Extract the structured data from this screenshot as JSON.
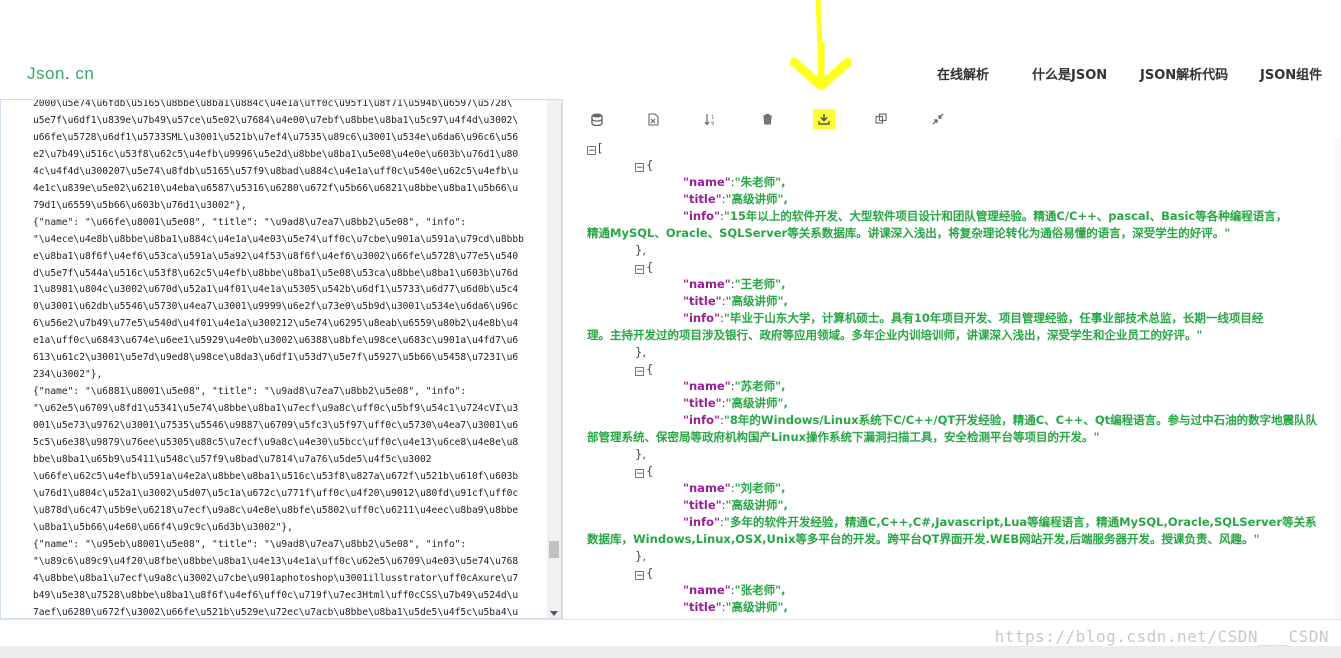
{
  "header": {
    "logo_main": "Json",
    "logo_dot": ".",
    "logo_tld": " cn",
    "nav": [
      "在线解析",
      "什么是JSON",
      "JSON解析代码",
      "JSON组件"
    ]
  },
  "editor_lines": [
    "2000\\u5e74\\u6fdb\\u5165\\u8bbe\\u8ba1\\u884c\\u4e1a\\uff0c\\u95f1\\u8f71\\u594b\\u6597\\u5728\\",
    "u5e7f\\u6df1\\u839e\\u7b49\\u57ce\\u5e02\\u7684\\u4e00\\u7ebf\\u8bbe\\u8ba1\\u5c97\\u4f4d\\u3002\\",
    "u66fe\\u5728\\u6df1\\u5733SML\\u3001\\u521b\\u7ef4\\u7535\\u89c6\\u3001\\u534e\\u6da6\\u96c6\\u56",
    "e2\\u7b49\\u516c\\u53f8\\u62c5\\u4efb\\u9996\\u5e2d\\u8bbe\\u8ba1\\u5e08\\u4e0e\\u603b\\u76d1\\u80",
    "4c\\u4f4d\\u300207\\u5e74\\u8fdb\\u5165\\u57f9\\u8bad\\u884c\\u4e1a\\uff0c\\u540e\\u62c5\\u4efb\\u",
    "4e1c\\u839e\\u5e02\\u6210\\u4eba\\u6587\\u5316\\u6280\\u672f\\u5b66\\u6821\\u8bbe\\u8ba1\\u5b66\\u",
    "79d1\\u6559\\u5b66\\u603b\\u76d1\\u3002\"},",
    "{\"name\": \"\\u66fe\\u8001\\u5e08\", \"title\": \"\\u9ad8\\u7ea7\\u8bb2\\u5e08\", \"info\":",
    "\"\\u4ece\\u4e8b\\u8bbe\\u8ba1\\u884c\\u4e1a\\u4e03\\u5e74\\uff0c\\u7cbe\\u901a\\u591a\\u79cd\\u8bbb",
    "e\\u8ba1\\u8f6f\\u4ef6\\u53ca\\u591a\\u5a92\\u4f53\\u8f6f\\u4ef6\\u3002\\u66fe\\u5728\\u77e5\\u540",
    "d\\u5e7f\\u544a\\u516c\\u53f8\\u62c5\\u4efb\\u8bbe\\u8ba1\\u5e08\\u53ca\\u8bbe\\u8ba1\\u603b\\u76d",
    "1\\u8981\\u804c\\u3002\\u670d\\u52a1\\u4f01\\u4e1a\\u5305\\u542b\\u6df1\\u5733\\u6d77\\u6d0b\\u5c4",
    "0\\u3001\\u62db\\u5546\\u5730\\u4ea7\\u3001\\u9999\\u6e2f\\u73e0\\u5b9d\\u3001\\u534e\\u6da6\\u96c",
    "6\\u56e2\\u7b49\\u77e5\\u540d\\u4f01\\u4e1a\\u300212\\u5e74\\u6295\\u8eab\\u6559\\u80b2\\u4e8b\\u4",
    "e1a\\uff0c\\u6843\\u674e\\u6ee1\\u5929\\u4e0b\\u3002\\u6388\\u8bfe\\u98ce\\u683c\\u901a\\u4fd7\\u6",
    "613\\u61c2\\u3001\\u5e7d\\u9ed8\\u98ce\\u8da3\\u6df1\\u53d7\\u5e7f\\u5927\\u5b66\\u5458\\u7231\\u6",
    "234\\u3002\"},",
    "{\"name\": \"\\u6881\\u8001\\u5e08\", \"title\": \"\\u9ad8\\u7ea7\\u8bb2\\u5e08\", \"info\":",
    "\"\\u62e5\\u6709\\u8fd1\\u5341\\u5e74\\u8bbe\\u8ba1\\u7ecf\\u9a8c\\uff0c\\u5bf9\\u54c1\\u724cVI\\u3",
    "001\\u5e73\\u9762\\u3001\\u7535\\u5546\\u9887\\u6709\\u5fc3\\u5f97\\uff0c\\u5730\\u4ea7\\u3001\\u6",
    "5c5\\u6e38\\u9879\\u76ee\\u5305\\u88c5\\u7ecf\\u9a8c\\u4e30\\u5bcc\\uff0c\\u4e13\\u6ce8\\u4e8e\\u8",
    "bbe\\u8ba1\\u65b9\\u5411\\u548c\\u57f9\\u8bad\\u7814\\u7a76\\u5de5\\u4f5c\\u3002",
    "\\u66fe\\u62c5\\u4efb\\u591a\\u4e2a\\u8bbe\\u8ba1\\u516c\\u53f8\\u827a\\u672f\\u521b\\u610f\\u603b",
    "\\u76d1\\u804c\\u52a1\\u3002\\u5d07\\u5c1a\\u672c\\u771f\\uff0c\\u4f20\\u9012\\u80fd\\u91cf\\uff0c",
    "\\u878d\\u6c47\\u5b9e\\u6218\\u7ecf\\u9a8c\\u4e8e\\u8bfe\\u5802\\uff0c\\u6211\\u4eec\\u8ba9\\u8bbe",
    "\\u8ba1\\u5b66\\u4e60\\u66f4\\u9c9c\\u6d3b\\u3002\"},",
    "{\"name\": \"\\u95eb\\u8001\\u5e08\", \"title\": \"\\u9ad8\\u7ea7\\u8bb2\\u5e08\", \"info\":",
    "\"\\u89c6\\u89c9\\u4f20\\u8fbe\\u8bbe\\u8ba1\\u4e13\\u4e1a\\uff0c\\u62e5\\u6709\\u4e03\\u5e74\\u768",
    "4\\u8bbe\\u8ba1\\u7ecf\\u9a8c\\u3002\\u7cbe\\u901aphotoshop\\u3001illusstrator\\uff0cAxure\\u7",
    "b49\\u5e38\\u7528\\u8bbe\\u8ba1\\u8f6f\\u4ef6\\uff0c\\u719f\\u7ec3Html\\uff0cCSS\\u7b49\\u524d\\u",
    "7aef\\u6280\\u672f\\u3002\\u66fe\\u521b\\u529e\\u72ec\\u7acb\\u8bbe\\u8ba1\\u5de5\\u4f5c\\u5ba4\\u"
  ],
  "toolbar": {
    "icons": [
      "database-icon",
      "excel-icon",
      "sort-icon",
      "trash-icon",
      "download-icon",
      "copy-icon",
      "compress-icon"
    ]
  },
  "json_view": {
    "open_bracket": "[",
    "teachers": [
      {
        "name": "朱老师",
        "title": "高级讲师",
        "info_1": "15年以上的软件开发、大型软件项目设计和团队管理经验。精通C/C++、pascal、Basic等各种编程语言，",
        "info_2": "精通MySQL、Oracle、SQLServer等关系数据库。讲课深入浅出，将复杂理论转化为通俗易懂的语言，深受学生的好评。\""
      },
      {
        "name": "王老师",
        "title": "高级讲师",
        "info_1": "毕业于山东大学，计算机硕士。具有10年项目开发、项目管理经验，任事业部技术总监，长期一线项目经",
        "info_2": "理。主持开发过的项目涉及银行、政府等应用领域。多年企业内训培训师，讲课深入浅出，深受学生和企业员工的好评。\""
      },
      {
        "name": "苏老师",
        "title": "高级讲师",
        "info_1": "8年的Windows/Linux系统下C/C++/QT开发经验，精通C、C++、Qt编程语言。参与过中石油的数字地震队队",
        "info_2": "部管理系统、保密局等政府机构国产Linux操作系统下漏洞扫描工具，安全检测平台等项目的开发。\""
      },
      {
        "name": "刘老师",
        "title": "高级讲师",
        "info_1": "多年的软件开发经验，精通C,C++,C#,Javascript,Lua等编程语言，精通MySQL,Oracle,SQLServer等关系",
        "info_2": "数据库，Windows,Linux,OSX,Unix等多平台的开发。跨平台QT界面开发.WEB网站开发,后端服务器开发。授课负责、风趣。\""
      },
      {
        "name": "张老师",
        "title": "高级讲师"
      }
    ]
  },
  "watermark": "https://blog.csdn.net/CSDN___CSDN",
  "colors": {
    "key": "#9b1d9b",
    "string": "#28a745",
    "highlight": "#ffff33",
    "logo": "#3aa56a"
  }
}
